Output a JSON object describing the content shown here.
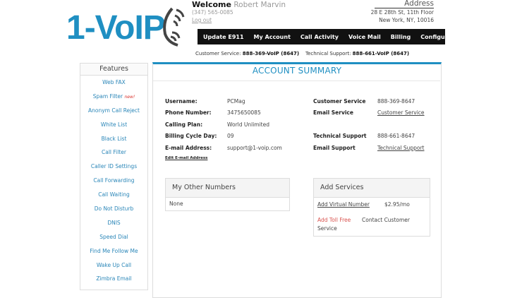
{
  "brand": {
    "logo_text": "1-VoIP",
    "color": "#1f8fc2"
  },
  "header": {
    "welcome_label": "Welcome",
    "user_name": "Robert Marvin",
    "phone": "(347) 565-0085",
    "logout_label": "Log out",
    "address_title": "Address",
    "address_line1": "28 E 28th St, 11th Floor",
    "address_line2": "New York, NY, 10016"
  },
  "nav": {
    "items": [
      "Update E911",
      "My Account",
      "Call Activity",
      "Voice Mail",
      "Billing",
      "Configure Device"
    ]
  },
  "support": {
    "cs_label": "Customer Service:",
    "cs_value": "888-369-VoIP (8647)",
    "ts_label": "Technical Support:",
    "ts_value": "888-661-VoIP (8647)"
  },
  "features": {
    "title": "Features",
    "items": [
      "Web FAX",
      "Spam Filter",
      "Anonym Call Reject",
      "White List",
      "Black List",
      "Call Filter",
      "Caller ID Settings",
      "Call Forwarding",
      "Call Waiting",
      "Do Not Disturb",
      "DNIS",
      "Speed Dial",
      "Find Me Follow Me",
      "Wake Up Call",
      "Zimbra Email"
    ],
    "new_badge": "new!"
  },
  "account": {
    "title": "ACCOUNT SUMMARY",
    "username_label": "Username:",
    "username": "PCMag",
    "phone_label": "Phone Number:",
    "phone": "3475650085",
    "plan_label": "Calling Plan:",
    "plan": "World Unlimited",
    "billing_label": "Billing Cycle Day:",
    "billing_day": "09",
    "email_label": "E-mail Address:",
    "email": "support@1-voip.com",
    "edit_email": "Edit E-mail Address",
    "cs_label": "Customer Service",
    "cs_value": "888-369-8647",
    "email_service_label": "Email Service",
    "email_service_link": "Customer Service",
    "ts_label": "Technical Support",
    "ts_value": "888-661-8647",
    "email_support_label": "Email Support",
    "email_support_link": "Technical Support"
  },
  "other_numbers": {
    "title": "My Other Numbers",
    "value": "None"
  },
  "add_services": {
    "title": "Add Services",
    "virtual_link": "Add Virtual Number",
    "virtual_price": "$2.95/mo",
    "tollfree_line1": "Add Toll Free",
    "tollfree_line2": "Service",
    "tollfree_value": "Contact Customer",
    "tollfree_color": "#d9534f"
  }
}
